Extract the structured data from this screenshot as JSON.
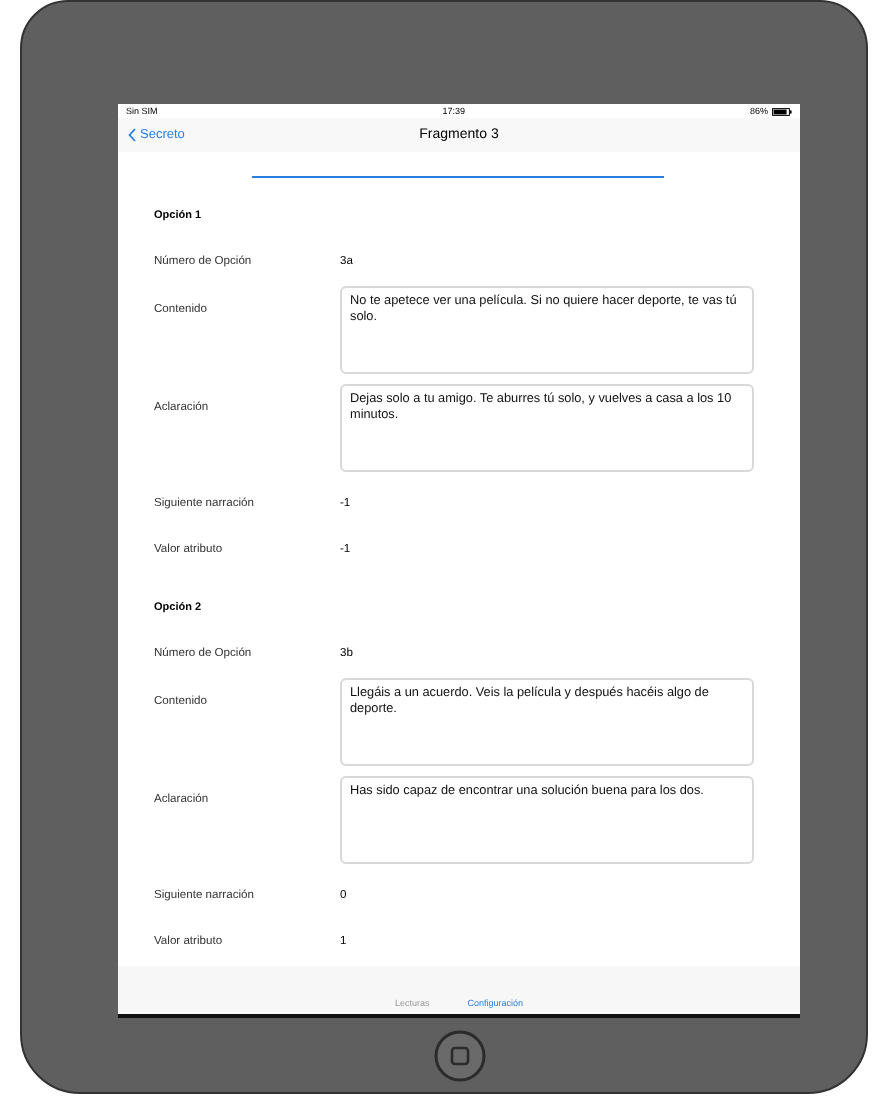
{
  "status_bar": {
    "carrier": "Sin SIM",
    "time": "17:39",
    "battery": "86%"
  },
  "nav": {
    "back": "Secreto",
    "title": "Fragmento 3"
  },
  "options": [
    {
      "heading": "Opción 1",
      "fields": [
        {
          "kind": "text",
          "label": "Número de Opción",
          "value": "3a"
        },
        {
          "kind": "area",
          "label": "Contenido",
          "value": "No te apetece ver una película. Si no quiere hacer deporte, te vas tú solo."
        },
        {
          "kind": "area",
          "label": "Aclaración",
          "value": "Dejas solo a tu amigo. Te aburres tú solo, y vuelves a casa a los 10 minutos."
        },
        {
          "kind": "text",
          "label": "Siguiente narración",
          "value": "-1"
        },
        {
          "kind": "text",
          "label": "Valor atributo",
          "value": "-1"
        }
      ]
    },
    {
      "heading": "Opción 2",
      "fields": [
        {
          "kind": "text",
          "label": "Número de Opción",
          "value": "3b"
        },
        {
          "kind": "area",
          "label": "Contenido",
          "value": "Llegáis a un acuerdo. Veis la película y después hacéis algo de deporte."
        },
        {
          "kind": "area",
          "label": "Aclaración",
          "value": "Has sido capaz de encontrar una solución buena para los dos."
        },
        {
          "kind": "text",
          "label": "Siguiente narración",
          "value": "0"
        },
        {
          "kind": "text",
          "label": "Valor atributo",
          "value": "1"
        }
      ]
    }
  ],
  "tabs": [
    {
      "label": "Lecturas",
      "selected": false
    },
    {
      "label": "Configuración",
      "selected": true
    }
  ]
}
